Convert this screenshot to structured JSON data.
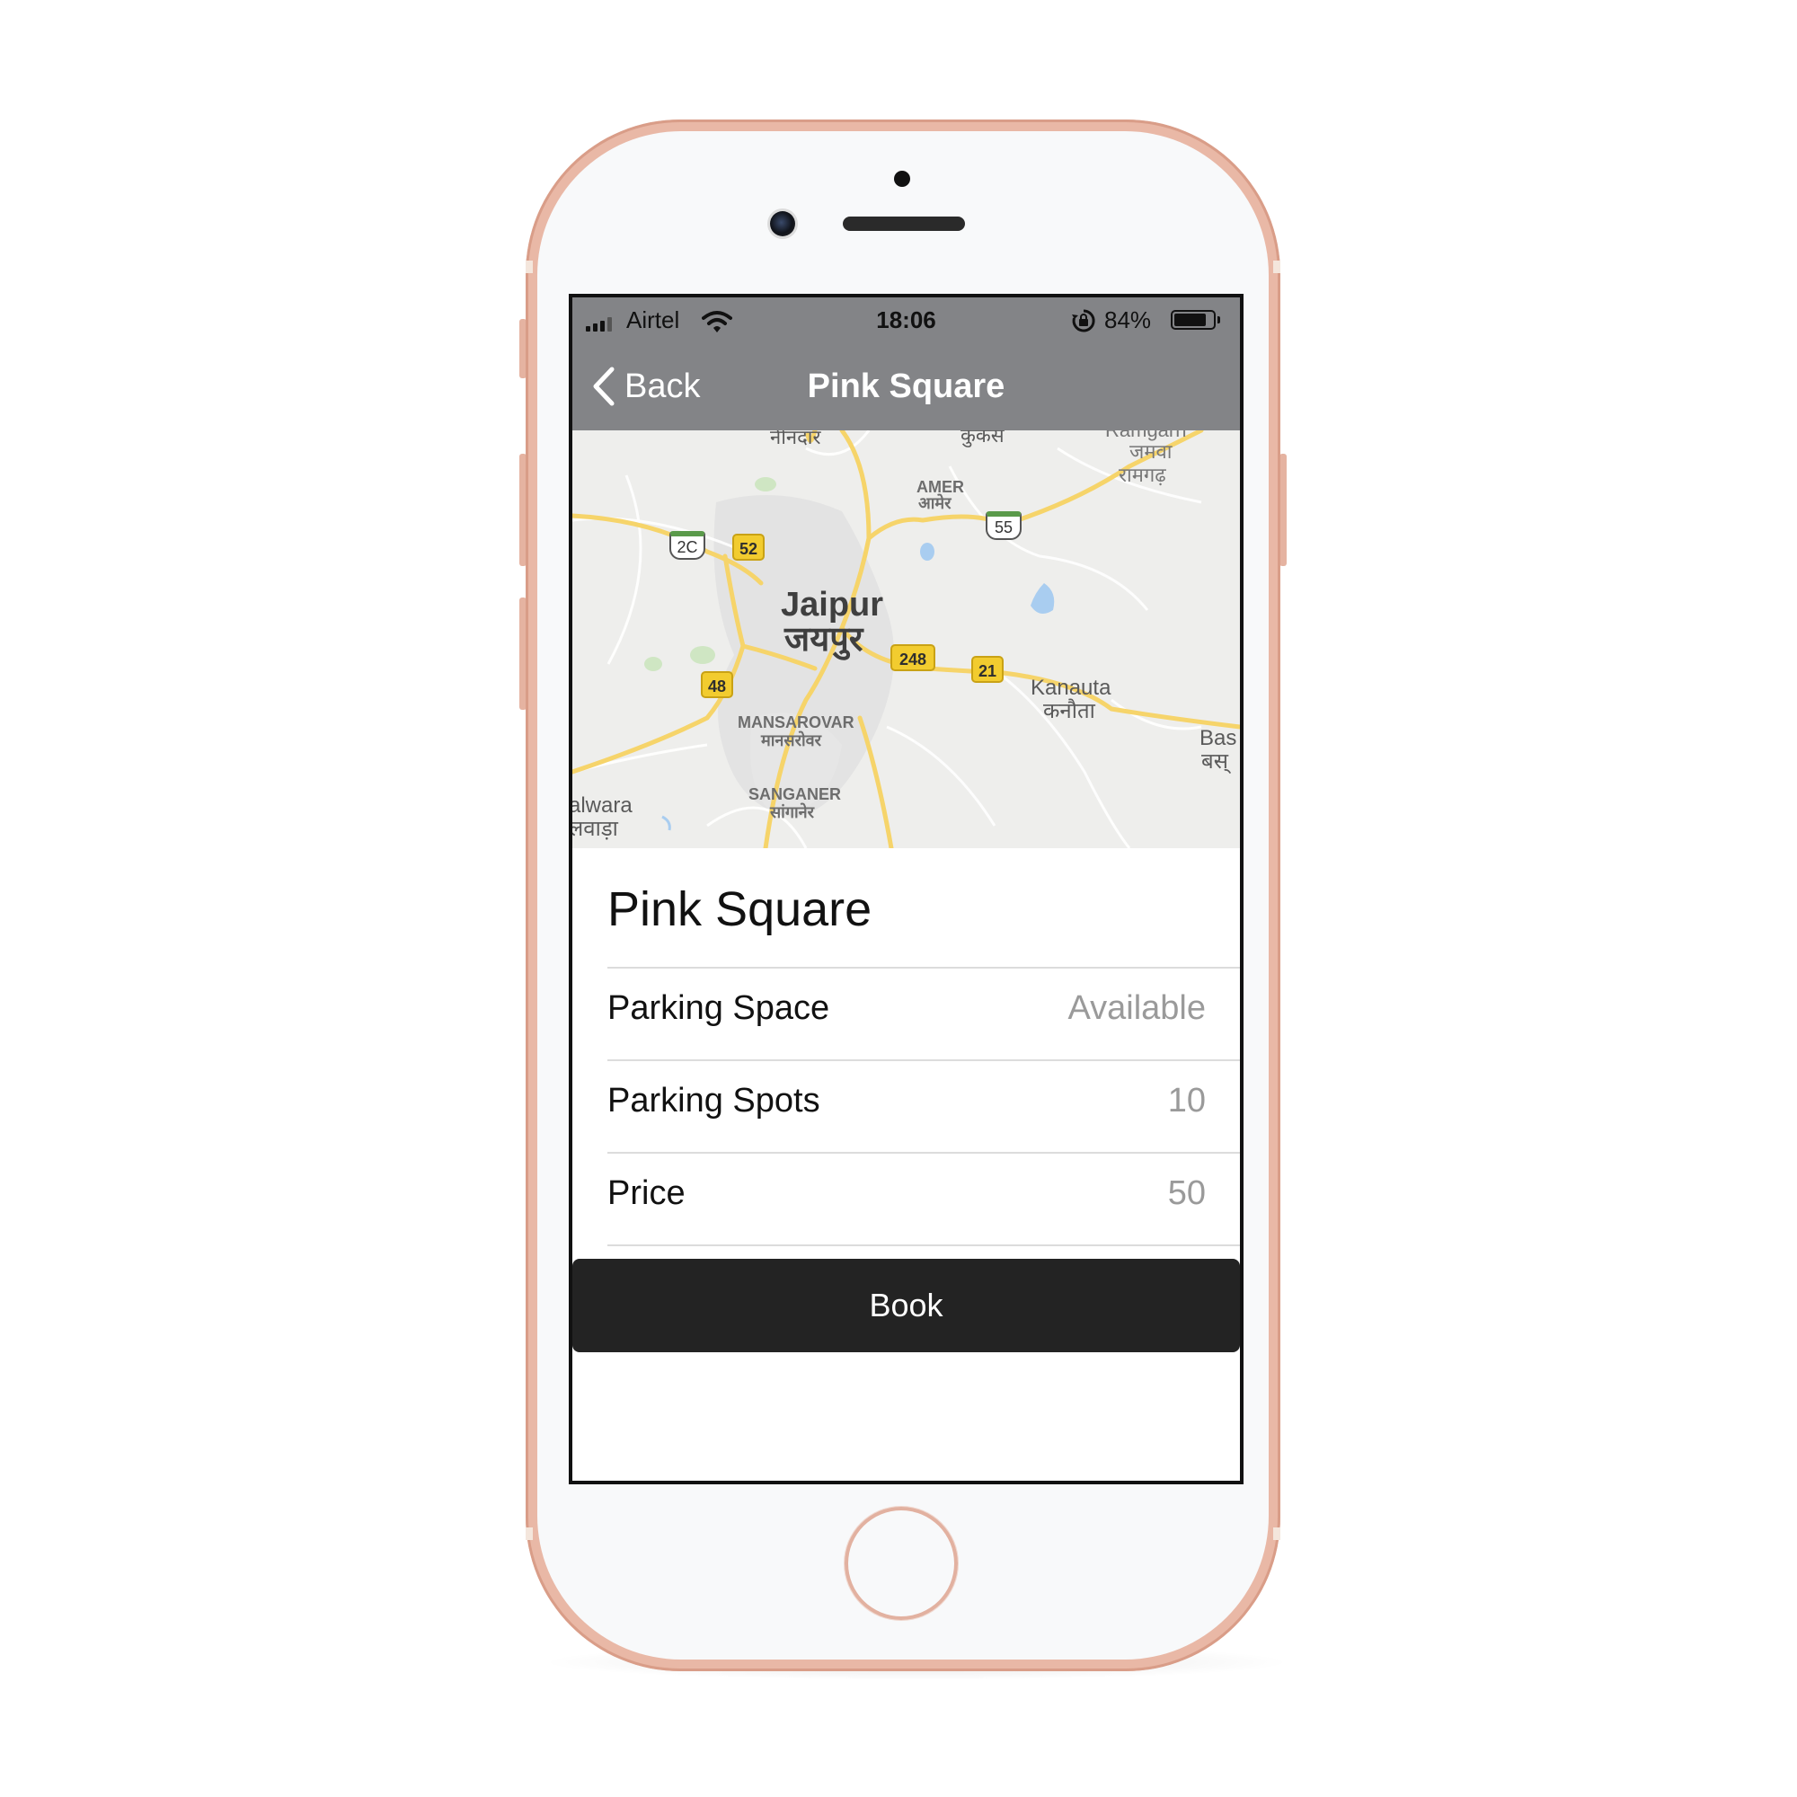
{
  "status_bar": {
    "carrier": "Airtel",
    "time": "18:06",
    "battery_percent": "84%",
    "battery_level": 0.84,
    "icons": [
      "signal-icon",
      "wifi-icon",
      "rotation-lock-icon",
      "battery-icon"
    ]
  },
  "nav": {
    "back_label": "Back",
    "back_icon": "chevron-left-icon",
    "title": "Pink Square"
  },
  "map": {
    "labels": {
      "nindar": "नीनदार",
      "kukas": "कुकस",
      "ramgarh_en": "Ramgarh",
      "jamwa": "जमवा",
      "ramgarh_hi": "रामगढ़",
      "amer_en": "AMER",
      "amer_hi": "आमेर",
      "jaipur_en": "Jaipur",
      "jaipur_hi": "जयपुर",
      "kanauta_en": "Kanauta",
      "kanauta_hi": "कनौता",
      "bassi_en": "Bas",
      "bassi_hi": "बस्",
      "mansarovar_en": "MANSAROVAR",
      "mansarovar_hi": "मानसरोवर",
      "sanganer_en": "SANGANER",
      "sanganer_hi": "सांगानेर",
      "bagru_en": "alwara",
      "bagru_hi": "लवाड़ा"
    },
    "shields": {
      "nh_2c": "2C",
      "nh_55": "55",
      "sh_52": "52",
      "sh_248": "248",
      "sh_21": "21",
      "sh_48": "48"
    },
    "colors": {
      "land": "#eeeeec",
      "road_major": "#f6d46a",
      "road_minor": "#ffffff",
      "urban": "#e2e2e2",
      "water": "#a9cdf0",
      "park": "#cfe6c3"
    }
  },
  "detail": {
    "title": "Pink Square",
    "rows": [
      {
        "label": "Parking Space",
        "value": "Available"
      },
      {
        "label": "Parking Spots",
        "value": "10"
      },
      {
        "label": "Price",
        "value": "50"
      }
    ],
    "book_label": "Book"
  },
  "colors": {
    "nav_bg": "#838487",
    "button_bg": "#232323",
    "value_text": "#9a9a9a",
    "device_frame": "#e9b8a6"
  }
}
